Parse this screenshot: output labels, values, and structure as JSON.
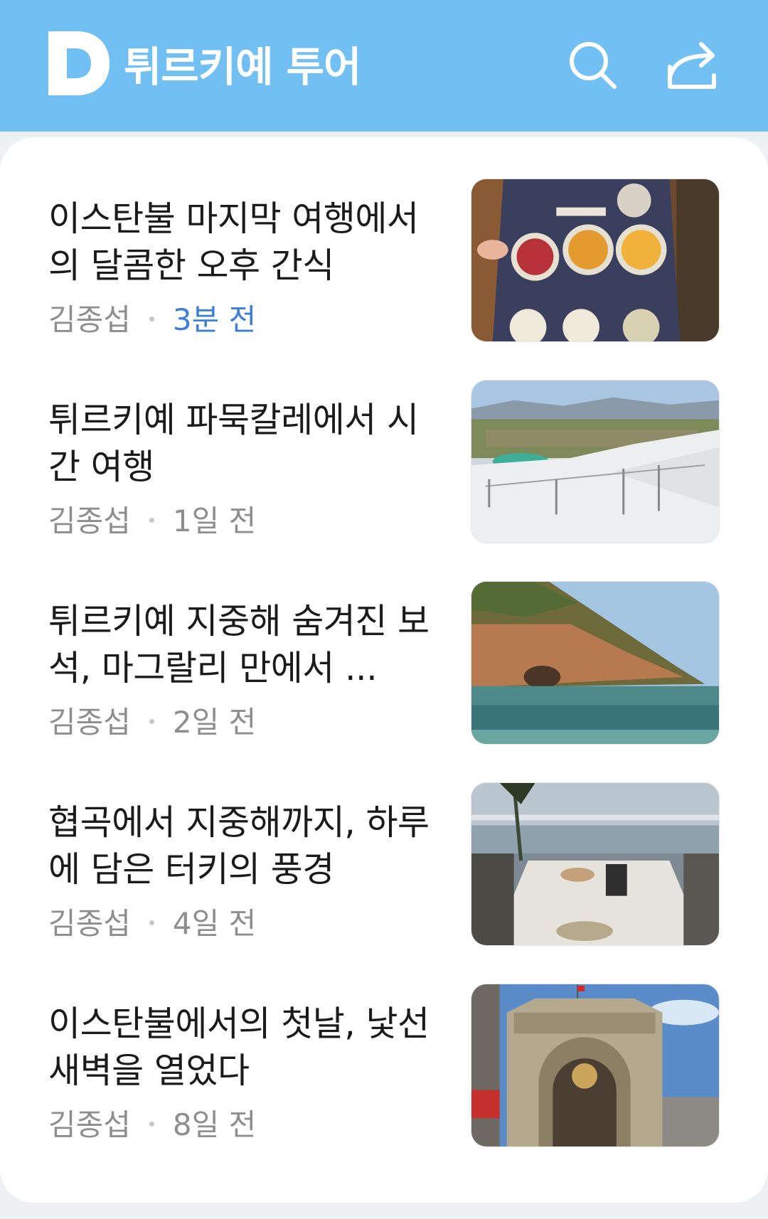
{
  "header": {
    "logo_letter": "D",
    "title": "튀르키예 투어",
    "search_icon": "search-icon",
    "share_icon": "share-icon",
    "background": "#72bff3"
  },
  "articles": [
    {
      "title": "이스탄불 마지막 여행에서의 달콤한 오후 간식",
      "author": "김종섭",
      "time": "3분 전",
      "thumbnail": "menu-photo"
    },
    {
      "title": "튀르키예 파묵칼레에서 시간 여행",
      "author": "김종섭",
      "time": "1일 전",
      "thumbnail": "pamukkale-photo"
    },
    {
      "title": "튀르키예 지중해 숨겨진 보석, 마그랄리 만에서 ...",
      "author": "김종섭",
      "time": "2일 전",
      "thumbnail": "bay-photo"
    },
    {
      "title": "협곡에서 지중해까지, 하루에 담은 터키의 풍경",
      "author": "김종섭",
      "time": "4일 전",
      "thumbnail": "terrace-photo"
    },
    {
      "title": "이스탄불에서의 첫날, 낯선 새벽을 열었다",
      "author": "김종섭",
      "time": "8일 전",
      "thumbnail": "bazaar-gate-photo"
    }
  ],
  "colors": {
    "accent_time": "#3b7fd6",
    "meta_text": "#8e8e8e",
    "title_text": "#1b1b1b"
  }
}
